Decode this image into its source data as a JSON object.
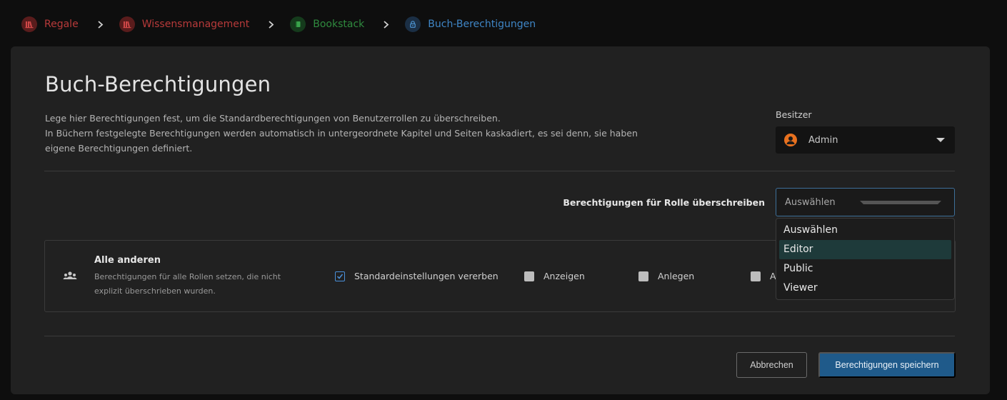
{
  "breadcrumb": {
    "items": [
      {
        "label": "Regale",
        "icon": "shelves-icon",
        "color": "#b83a3a",
        "badge": "#5a1c1c"
      },
      {
        "label": "Wissensmanagement",
        "icon": "shelves-icon",
        "color": "#b83a3a",
        "badge": "#5a1c1c"
      },
      {
        "label": "Bookstack",
        "icon": "book-icon",
        "color": "#2f8a3e",
        "badge": "#153b1c"
      },
      {
        "label": "Buch-Berechtigungen",
        "icon": "lock-icon",
        "color": "#3f86c6",
        "badge": "#1b2f45"
      }
    ]
  },
  "page": {
    "title": "Buch-Berechtigungen",
    "description_line1": "Lege hier Berechtigungen fest, um die Standardberechtigungen von Benutzerrollen zu überschreiben.",
    "description_line2": "In Büchern festgelegte Berechtigungen werden automatisch in untergeordnete Kapitel und Seiten kaskadiert, es sei denn, sie haben eigene Berechtigungen definiert."
  },
  "owner": {
    "label": "Besitzer",
    "value": "Admin",
    "avatar_icon": "user-avatar-icon",
    "avatar_color": "#e8711f"
  },
  "role_override": {
    "label": "Berechtigungen für Rolle überschreiben",
    "selected": "Auswählen",
    "options": [
      "Auswählen",
      "Editor",
      "Public",
      "Viewer"
    ],
    "highlighted": "Editor"
  },
  "everyone_else": {
    "icon": "users-group-icon",
    "title": "Alle anderen",
    "description": "Berechtigungen für alle Rollen setzen, die nicht explizit überschrieben wurden.",
    "inherit": {
      "label": "Standardeinstellungen vererben",
      "checked": true
    },
    "permissions": [
      {
        "label": "Anzeigen",
        "checked": false
      },
      {
        "label": "Anlegen",
        "checked": false
      },
      {
        "label": "A",
        "checked": false
      }
    ]
  },
  "actions": {
    "cancel": "Abbrechen",
    "save": "Berechtigungen speichern"
  },
  "colors": {
    "accent": "#1f5a8a",
    "focus_border": "#3d6f99",
    "checkbox_accent": "#4a90d9"
  }
}
